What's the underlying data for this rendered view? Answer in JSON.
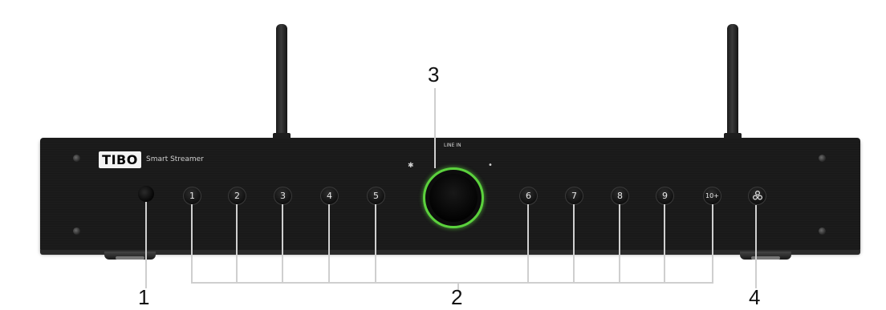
{
  "device": {
    "brand": "TIBO",
    "model": "Smart Streamer",
    "line_in_label": "LINE IN",
    "bluetooth_icon": "bluetooth-icon",
    "wifi_icon": "wifi-icon",
    "ring_color": "#5bd13d"
  },
  "presets": [
    "1",
    "2",
    "3",
    "4",
    "5",
    "6",
    "7",
    "8",
    "9",
    "10+"
  ],
  "callouts": {
    "c1": "1",
    "c2": "2",
    "c3": "3",
    "c4": "4"
  }
}
